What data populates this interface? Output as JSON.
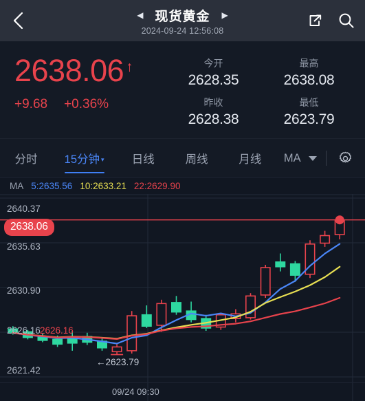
{
  "header": {
    "back_icon": "chevron-left-icon",
    "prev_icon": "triangle-left-icon",
    "next_icon": "triangle-right-icon",
    "title": "现货黄金",
    "timestamp": "2024-09-24 12:56:08",
    "share_icon": "external-link-icon",
    "search_icon": "search-icon",
    "bg_color": "#2b303b"
  },
  "quote": {
    "last_price": "2638.06",
    "direction_caret": "↑",
    "change_abs": "+9.68",
    "change_pct": "+0.36%",
    "up_color": "#e8434c",
    "stats": [
      {
        "label": "今开",
        "value": "2628.35"
      },
      {
        "label": "最高",
        "value": "2638.08"
      },
      {
        "label": "昨收",
        "value": "2628.38"
      },
      {
        "label": "最低",
        "value": "2623.79"
      }
    ]
  },
  "tabs": {
    "items": [
      {
        "label": "分时",
        "active": false
      },
      {
        "label": "15分钟",
        "active": true,
        "caret": "▾"
      },
      {
        "label": "日线",
        "active": false
      },
      {
        "label": "周线",
        "active": false
      },
      {
        "label": "月线",
        "active": false
      }
    ],
    "ma_label": "MA",
    "gear_icon": "gear-icon",
    "active_color": "#4a86f7"
  },
  "ma_legend": {
    "lead": "MA",
    "ma5": "5:2635.56",
    "ma10": "10:2633.21",
    "ma22": "22:2629.90",
    "ma5_color": "#4a86f7",
    "ma10_color": "#e8df52",
    "ma22_color": "#e8434c"
  },
  "chart_annotations": {
    "price_badge": "2638.06",
    "low_marker": "←2623.79",
    "inline_marker": "2626.16",
    "x_label": "09/24 09:30"
  },
  "chart_data": {
    "type": "candlestick",
    "title": "现货黄金 15分钟",
    "xlabel": "",
    "ylabel": "",
    "x_tick_labels": [
      "09/24 09:30"
    ],
    "y_tick_labels": [
      "2640.37",
      "2635.63",
      "2630.90",
      "2626.16",
      "2621.42"
    ],
    "ylim": [
      2621.42,
      2640.37
    ],
    "grid": true,
    "legend_position": "top-left",
    "up_color": "#e8434c",
    "down_color": "#2ed8a0",
    "current_price": 2638.06,
    "current_price_line": 2638.06,
    "open": 2628.35,
    "high": 2638.08,
    "low": 2623.79,
    "prev_close": 2628.38,
    "candles": [
      {
        "o": 2626.5,
        "h": 2626.8,
        "l": 2625.9,
        "c": 2626.1,
        "dir": "down"
      },
      {
        "o": 2626.2,
        "h": 2626.4,
        "l": 2625.4,
        "c": 2625.6,
        "dir": "down"
      },
      {
        "o": 2625.7,
        "h": 2626.0,
        "l": 2625.1,
        "c": 2625.3,
        "dir": "down"
      },
      {
        "o": 2625.4,
        "h": 2625.8,
        "l": 2624.6,
        "c": 2624.9,
        "dir": "down"
      },
      {
        "o": 2625.0,
        "h": 2626.3,
        "l": 2624.2,
        "c": 2625.6,
        "dir": "down"
      },
      {
        "o": 2625.7,
        "h": 2626.1,
        "l": 2624.8,
        "c": 2625.1,
        "dir": "down"
      },
      {
        "o": 2625.2,
        "h": 2625.6,
        "l": 2624.2,
        "c": 2624.5,
        "dir": "down"
      },
      {
        "o": 2624.6,
        "h": 2625.0,
        "l": 2623.79,
        "c": 2624.1,
        "dir": "up"
      },
      {
        "o": 2624.2,
        "h": 2628.4,
        "l": 2623.9,
        "c": 2627.9,
        "dir": "up"
      },
      {
        "o": 2628.0,
        "h": 2629.0,
        "l": 2626.6,
        "c": 2626.8,
        "dir": "down"
      },
      {
        "o": 2626.9,
        "h": 2629.6,
        "l": 2626.2,
        "c": 2629.2,
        "dir": "up"
      },
      {
        "o": 2629.3,
        "h": 2630.0,
        "l": 2628.0,
        "c": 2628.3,
        "dir": "down"
      },
      {
        "o": 2628.4,
        "h": 2629.4,
        "l": 2627.2,
        "c": 2627.5,
        "dir": "down"
      },
      {
        "o": 2627.6,
        "h": 2628.0,
        "l": 2626.3,
        "c": 2626.6,
        "dir": "down"
      },
      {
        "o": 2626.7,
        "h": 2628.2,
        "l": 2626.4,
        "c": 2628.0,
        "dir": "up"
      },
      {
        "o": 2628.1,
        "h": 2628.6,
        "l": 2627.2,
        "c": 2627.6,
        "dir": "up"
      },
      {
        "o": 2627.7,
        "h": 2630.3,
        "l": 2627.5,
        "c": 2630.0,
        "dir": "up"
      },
      {
        "o": 2630.1,
        "h": 2633.3,
        "l": 2629.8,
        "c": 2633.0,
        "dir": "up"
      },
      {
        "o": 2633.1,
        "h": 2634.5,
        "l": 2632.6,
        "c": 2633.6,
        "dir": "down"
      },
      {
        "o": 2633.4,
        "h": 2633.7,
        "l": 2631.5,
        "c": 2632.2,
        "dir": "down"
      },
      {
        "o": 2632.3,
        "h": 2635.9,
        "l": 2631.9,
        "c": 2635.5,
        "dir": "up"
      },
      {
        "o": 2635.6,
        "h": 2636.9,
        "l": 2635.2,
        "c": 2636.4,
        "dir": "up"
      },
      {
        "o": 2636.5,
        "h": 2638.08,
        "l": 2636.0,
        "c": 2638.06,
        "dir": "up"
      }
    ],
    "series": [
      {
        "name": "MA5",
        "color": "#4a86f7",
        "last_value": 2635.56
      },
      {
        "name": "MA10",
        "color": "#e8df52",
        "last_value": 2633.21
      },
      {
        "name": "MA22",
        "color": "#e8434c",
        "last_value": 2629.9
      }
    ]
  }
}
